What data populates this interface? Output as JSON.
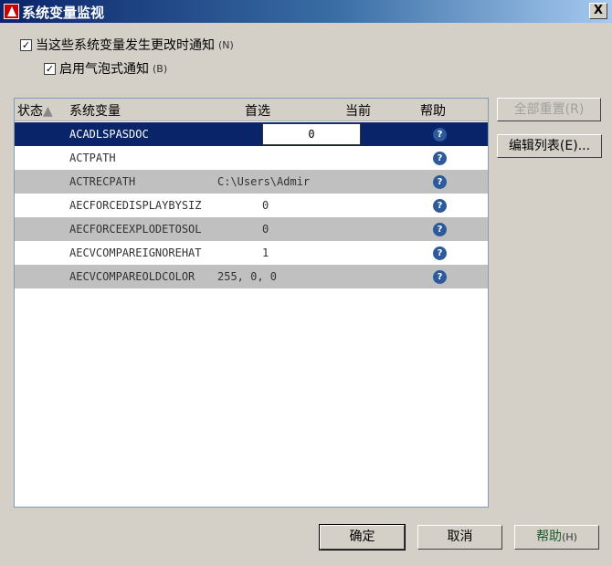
{
  "window": {
    "title": "系统变量监视",
    "close": "X"
  },
  "options": {
    "notify_on_change": {
      "label": "当这些系统变量发生更改时通知",
      "accel": "(N)",
      "checked": true
    },
    "balloon": {
      "label": "启用气泡式通知",
      "accel": "(B)",
      "checked": true
    }
  },
  "table": {
    "headers": {
      "status": "状态",
      "sort_icon": "▲",
      "variable": "系统变量",
      "preferred": "首选",
      "current": "当前",
      "help": "帮助"
    },
    "rows": [
      {
        "name": "ACADLSPASDOC",
        "preferred": "0",
        "current": "",
        "help": "?"
      },
      {
        "name": "ACTPATH",
        "preferred": "",
        "current": "",
        "help": "?"
      },
      {
        "name": "ACTRECPATH",
        "preferred": "C:\\Users\\Admir",
        "current": "",
        "help": "?"
      },
      {
        "name": "AECFORCEDISPLAYBYSIZ",
        "preferred": "0",
        "current": "",
        "help": "?"
      },
      {
        "name": "AECFORCEEXPLODETOSOL",
        "preferred": "0",
        "current": "",
        "help": "?"
      },
      {
        "name": "AECVCOMPAREIGNOREHAT",
        "preferred": "1",
        "current": "",
        "help": "?"
      },
      {
        "name": "AECVCOMPAREOLDCOLOR",
        "preferred": "255, 0, 0",
        "current": "",
        "help": "?"
      }
    ]
  },
  "side_buttons": {
    "reset_all": "全部重置(R)",
    "edit_list": "编辑列表(E)..."
  },
  "footer": {
    "ok": "确定",
    "cancel": "取消",
    "help": "帮助",
    "help_accel": "(H)"
  }
}
